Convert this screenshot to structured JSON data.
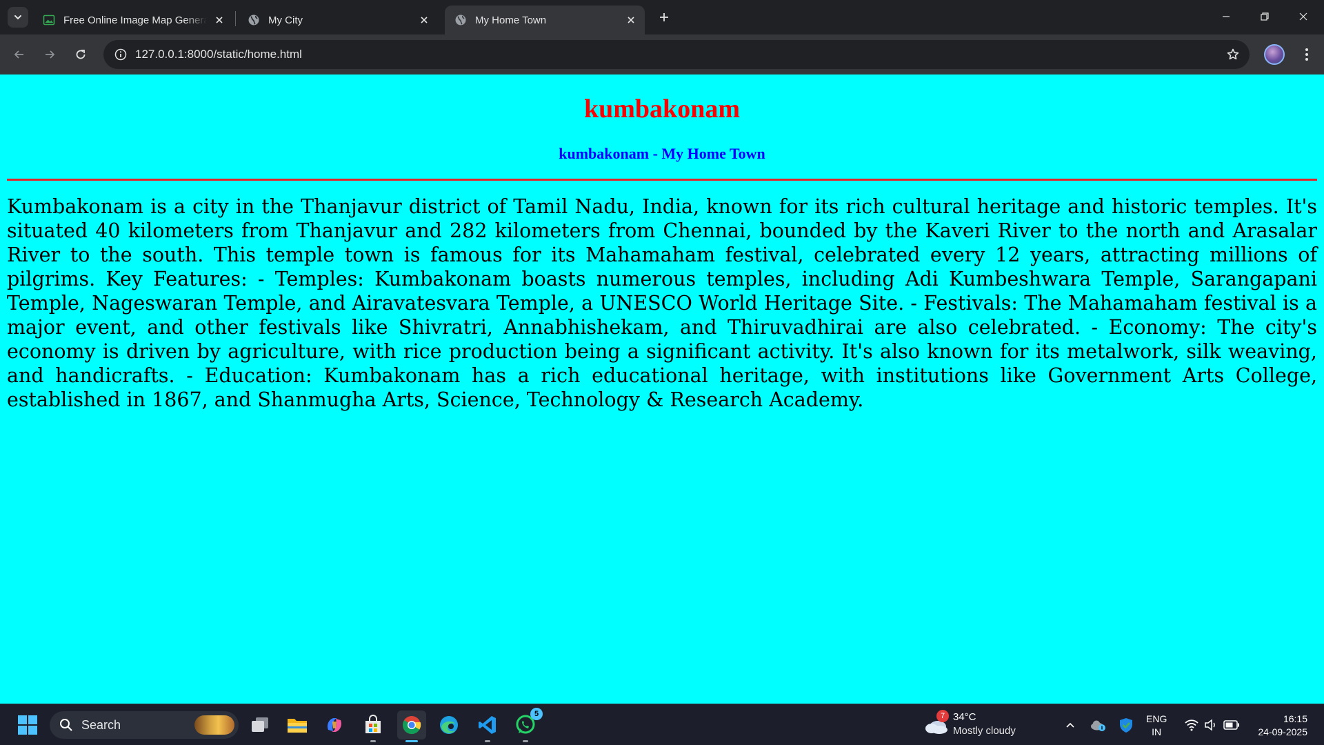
{
  "browser": {
    "tabs": [
      {
        "title": "Free Online Image Map Generator",
        "favicon": "image-icon"
      },
      {
        "title": "My City",
        "favicon": "globe-icon"
      },
      {
        "title": "My Home Town",
        "favicon": "globe-icon",
        "active": true
      }
    ],
    "url": "127.0.0.1:8000/static/home.html"
  },
  "page": {
    "heading": "kumbakonam",
    "subheading": "kumbakonam - My Home Town",
    "background_color": "#00ffff",
    "heading_color": "#ff0000",
    "subheading_color": "#0000ff",
    "paragraph": "Kumbakonam is a city in the Thanjavur district of Tamil Nadu, India, known for its rich cultural heritage and historic temples. It's situated 40 kilometers from Thanjavur and 282 kilometers from Chennai, bounded by the Kaveri River to the north and Arasalar River to the south. This temple town is famous for its Mahamaham festival, celebrated every 12 years, attracting millions of pilgrims. Key Features: - Temples: Kumbakonam boasts numerous temples, including Adi Kumbeshwara Temple, Sarangapani Temple, Nageswaran Temple, and Airavatesvara Temple, a UNESCO World Heritage Site. - Festivals: The Mahamaham festival is a major event, and other festivals like Shivratri, Annabhishekam, and Thiruvadhirai are also celebrated. - Economy: The city's economy is driven by agriculture, with rice production being a significant activity. It's also known for its metalwork, silk weaving, and handicrafts. - Education: Kumbakonam has a rich educational heritage, with institutions like Government Arts College, established in 1867, and Shanmugha Arts, Science, Technology & Research Academy."
  },
  "taskbar": {
    "search_label": "Search",
    "whatsapp_badge": "5",
    "weather": {
      "badge": "7",
      "temperature": "34°C",
      "condition": "Mostly cloudy"
    },
    "language": {
      "line1": "ENG",
      "line2": "IN"
    },
    "clock": {
      "time": "16:15",
      "date": "24-09-2025"
    }
  }
}
